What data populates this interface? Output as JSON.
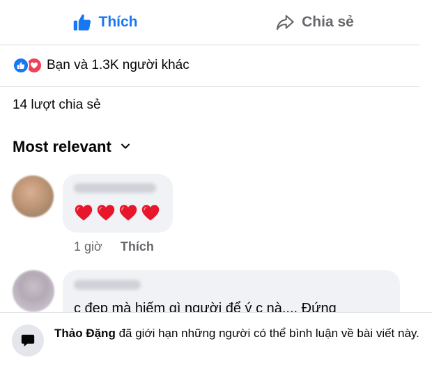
{
  "actions": {
    "like_label": "Thích",
    "share_label": "Chia sẻ"
  },
  "reactions": {
    "summary": "Bạn và 1.3K người khác"
  },
  "shares": {
    "text": "14 lượt chia sẻ"
  },
  "sort": {
    "label": "Most relevant"
  },
  "comments": [
    {
      "content": "❤️❤️❤️❤️",
      "time": "1 giờ",
      "like_label": "Thích"
    },
    {
      "content": "c đẹp mà hiếm gì người để ý c nà.... Đứng"
    }
  ],
  "restriction": {
    "author": "Thảo Đặng",
    "message": "đã giới hạn những người có thể bình luận về bài viết này."
  },
  "colors": {
    "accent": "#1877f2",
    "love": "#f33e58",
    "muted": "#65676b",
    "bubble": "#f0f2f5"
  }
}
